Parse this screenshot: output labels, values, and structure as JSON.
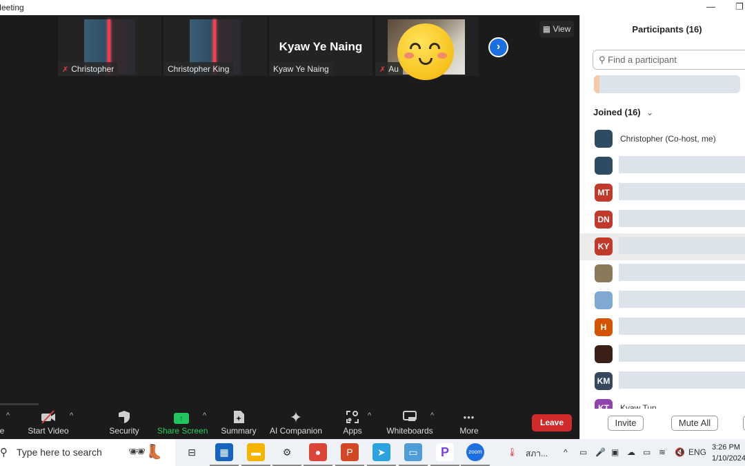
{
  "window": {
    "title": "Meeting",
    "minimize": "—",
    "restore": "❐"
  },
  "video_strip": {
    "tiles": [
      {
        "name": "Christopher",
        "muted": true,
        "type": "avatar"
      },
      {
        "name": "Christopher King",
        "muted": false,
        "type": "avatar"
      },
      {
        "name": "Kyaw Ye Naing",
        "display": "Kyaw Ye Naing",
        "muted": false,
        "type": "name"
      },
      {
        "name": "Au",
        "muted": true,
        "type": "video"
      }
    ],
    "next_icon": "›",
    "view_label": "View",
    "view_icon": "▦"
  },
  "toolbar": {
    "items": [
      {
        "label": "e",
        "icon": ""
      },
      {
        "label": "Start Video",
        "icon": "video-off"
      },
      {
        "label": "Security",
        "icon": "shield"
      },
      {
        "label": "Share Screen",
        "icon": "↑"
      },
      {
        "label": "Summary",
        "icon": "summary"
      },
      {
        "label": "AI Companion",
        "icon": "✦"
      },
      {
        "label": "Apps",
        "icon": "apps"
      },
      {
        "label": "Whiteboards",
        "icon": "whiteboard"
      },
      {
        "label": "More",
        "icon": "•••"
      }
    ],
    "caret": "^",
    "leave_label": "Leave"
  },
  "participants": {
    "title": "Participants (16)",
    "search_placeholder": "Find a participant",
    "search_icon": "⚲",
    "joined_label": "Joined (16)",
    "joined_chevron": "⌄",
    "list": [
      {
        "initials": "",
        "name": "Christopher (Co-host, me)",
        "color": "#2d4b62",
        "redacted": false
      },
      {
        "initials": "",
        "name": "",
        "color": "#2d4b62",
        "redacted": true
      },
      {
        "initials": "MT",
        "name": "",
        "color": "#c0392b",
        "redacted": true
      },
      {
        "initials": "DN",
        "name": "",
        "color": "#c0392b",
        "redacted": true
      },
      {
        "initials": "KY",
        "name": "",
        "color": "#c0392b",
        "redacted": true
      },
      {
        "initials": "",
        "name": "",
        "color": "#8a7a5a",
        "redacted": true
      },
      {
        "initials": "",
        "name": "",
        "color": "#7fa9d0",
        "redacted": true
      },
      {
        "initials": "H",
        "name": "",
        "color": "#d35400",
        "redacted": true
      },
      {
        "initials": "",
        "name": "",
        "color": "#3a2018",
        "redacted": true
      },
      {
        "initials": "KM",
        "name": "",
        "color": "#34495e",
        "redacted": true
      },
      {
        "initials": "KT",
        "name": "Kyaw Tun",
        "color": "#8e44ad",
        "redacted": false
      }
    ],
    "invite_label": "Invite",
    "mute_all_label": "Mute All"
  },
  "taskbar": {
    "search_placeholder": "Type here to search",
    "search_icon": "⚲",
    "apps": [
      {
        "name": "task-view",
        "glyph": "⊟",
        "color": "transparent"
      },
      {
        "name": "microsoft-store",
        "glyph": "▦",
        "color": "#1565c0"
      },
      {
        "name": "file-explorer",
        "glyph": "▬",
        "color": "#f4b400"
      },
      {
        "name": "settings",
        "glyph": "⚙",
        "color": "transparent"
      },
      {
        "name": "chrome",
        "glyph": "●",
        "color": "#db4437"
      },
      {
        "name": "powerpoint",
        "glyph": "P",
        "color": "#d24726"
      },
      {
        "name": "telegram",
        "glyph": "➤",
        "color": "#2aa3df"
      },
      {
        "name": "control-panel",
        "glyph": "▭",
        "color": "#4f9cd6"
      },
      {
        "name": "p-app",
        "glyph": "P",
        "color": "#ffffff"
      },
      {
        "name": "zoom",
        "glyph": "zoom",
        "color": "#1b6fe0"
      }
    ],
    "weather_text": "สภา...",
    "tray": [
      "^",
      "▭",
      "🎤",
      "▣",
      "☁",
      "▭",
      "≋",
      "🔇"
    ],
    "language": "ENG",
    "time": "3:26 PM",
    "date": "1/10/2024"
  }
}
